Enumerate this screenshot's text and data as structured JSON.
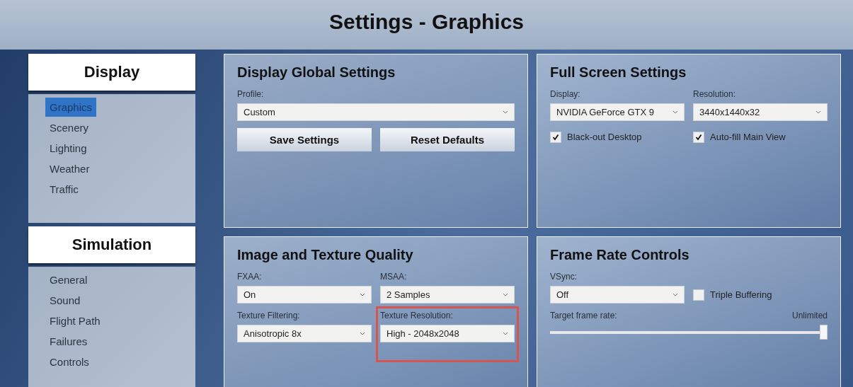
{
  "window": {
    "title": "Settings - Graphics"
  },
  "sidebar": {
    "sections": [
      {
        "heading": "Display",
        "items": [
          {
            "label": "Graphics",
            "selected": true
          },
          {
            "label": "Scenery",
            "selected": false
          },
          {
            "label": "Lighting",
            "selected": false
          },
          {
            "label": "Weather",
            "selected": false
          },
          {
            "label": "Traffic",
            "selected": false
          }
        ]
      },
      {
        "heading": "Simulation",
        "items": [
          {
            "label": "General",
            "selected": false
          },
          {
            "label": "Sound",
            "selected": false
          },
          {
            "label": "Flight Path",
            "selected": false
          },
          {
            "label": "Failures",
            "selected": false
          },
          {
            "label": "Controls",
            "selected": false
          }
        ]
      }
    ]
  },
  "panels": [
    {
      "title": "Display Global Settings",
      "rows": [
        [
          {
            "kind": "select",
            "label": "Profile:",
            "value": "Custom",
            "highlighted": false
          }
        ],
        [
          {
            "kind": "button",
            "label": "Save Settings"
          },
          {
            "kind": "button",
            "label": "Reset Defaults"
          }
        ]
      ]
    },
    {
      "title": "Full Screen Settings",
      "rows": [
        [
          {
            "kind": "select",
            "label": "Display:",
            "value": "NVIDIA GeForce GTX 9",
            "highlighted": false
          },
          {
            "kind": "select",
            "label": "Resolution:",
            "value": "3440x1440x32",
            "highlighted": false
          }
        ],
        [
          {
            "kind": "checkbox",
            "label": "Black-out Desktop",
            "checked": true
          },
          {
            "kind": "checkbox",
            "label": "Auto-fill Main View",
            "checked": true
          }
        ]
      ]
    },
    {
      "title": "Image and Texture Quality",
      "rows": [
        [
          {
            "kind": "select",
            "label": "FXAA:",
            "value": "On",
            "highlighted": false
          },
          {
            "kind": "select",
            "label": "MSAA:",
            "value": "2 Samples",
            "highlighted": false
          }
        ],
        [
          {
            "kind": "select",
            "label": "Texture Filtering:",
            "value": "Anisotropic 8x",
            "highlighted": false
          },
          {
            "kind": "select",
            "label": "Texture Resolution:",
            "value": "High - 2048x2048",
            "highlighted": true
          }
        ]
      ]
    },
    {
      "title": "Frame Rate Controls",
      "rows": [
        [
          {
            "kind": "select",
            "label": "VSync:",
            "value": "Off",
            "highlighted": false
          },
          {
            "kind": "checkbox",
            "label": "Triple Buffering",
            "checked": false
          }
        ],
        [
          {
            "kind": "slider",
            "label": "Target frame rate:",
            "reading": "Unlimited",
            "level": 1
          }
        ]
      ]
    }
  ]
}
